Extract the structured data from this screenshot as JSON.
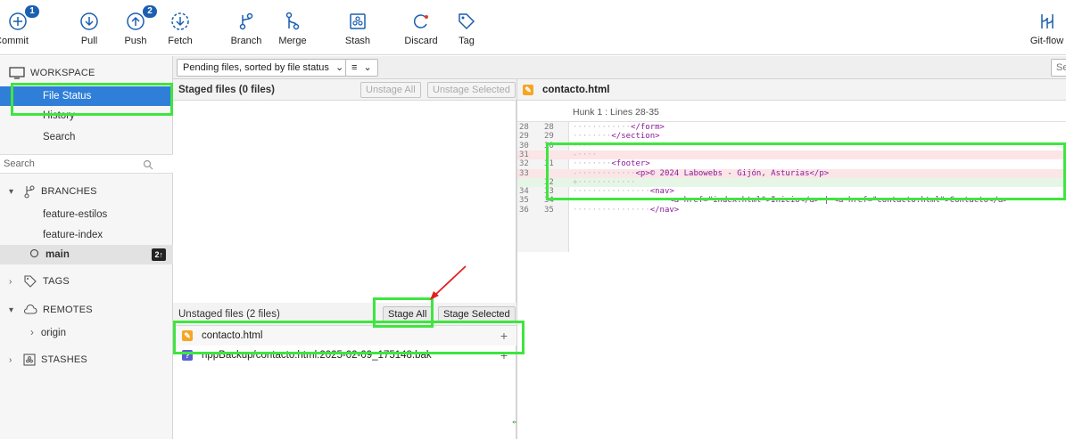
{
  "toolbar": {
    "buttons": [
      {
        "key": "commit",
        "label": "Commit",
        "badge": "1"
      },
      {
        "key": "pull",
        "label": "Pull",
        "badge": ""
      },
      {
        "key": "push",
        "label": "Push",
        "badge": "2"
      },
      {
        "key": "fetch",
        "label": "Fetch",
        "badge": ""
      },
      {
        "key": "branch",
        "label": "Branch",
        "badge": ""
      },
      {
        "key": "merge",
        "label": "Merge",
        "badge": ""
      },
      {
        "key": "stash",
        "label": "Stash",
        "badge": ""
      },
      {
        "key": "discard",
        "label": "Discard",
        "badge": ""
      },
      {
        "key": "tag",
        "label": "Tag",
        "badge": ""
      },
      {
        "key": "gitflow",
        "label": "Git-flow",
        "badge": ""
      }
    ]
  },
  "sidebar": {
    "workspace_label": "WORKSPACE",
    "workspace_items": [
      "File Status",
      "History",
      "Search"
    ],
    "search_placeholder": "Search",
    "branches_label": "BRANCHES",
    "branches": [
      "feature-estilos",
      "feature-index",
      "main"
    ],
    "main_badge": "2↑",
    "tags_label": "TAGS",
    "remotes_label": "REMOTES",
    "remotes": [
      "origin"
    ],
    "stashes_label": "STASHES"
  },
  "filter": {
    "sort_label": "Pending files, sorted by file status",
    "view_icon": "≡",
    "search_placeholder": "Se"
  },
  "staged": {
    "title": "Staged files  (0 files)",
    "unstage_all": "Unstage All",
    "unstage_selected": "Unstage Selected"
  },
  "unstaged": {
    "title": "Unstaged files  (2 files)",
    "stage_all": "Stage All",
    "stage_selected": "Stage Selected",
    "files": [
      "contacto.html",
      "nppBackup/contacto.html.2025-02-09_175148.bak"
    ]
  },
  "diff": {
    "file": "contacto.html",
    "hunk": "Hunk 1 : Lines 28-35",
    "lines": [
      {
        "old": "28",
        "new": "28",
        "type": "ctx",
        "text": "</form>"
      },
      {
        "old": "29",
        "new": "29",
        "type": "ctx",
        "text": "</section>"
      },
      {
        "old": "30",
        "new": "30",
        "type": "ctx",
        "text": ""
      },
      {
        "old": "31",
        "new": "",
        "type": "del",
        "text": ""
      },
      {
        "old": "32",
        "new": "31",
        "type": "ctx",
        "text": "<footer>"
      },
      {
        "old": "33",
        "new": "",
        "type": "del",
        "text": "<p>© 2024 Labowebs - Gijón, Asturias</p>"
      },
      {
        "old": "",
        "new": "32",
        "type": "add",
        "text": ""
      },
      {
        "old": "34",
        "new": "33",
        "type": "ctx",
        "text": "<nav>"
      },
      {
        "old": "35",
        "new": "34",
        "type": "ctx",
        "text": "<a href=\"index.html\">Inicio</a> | <a href=\"contacto.html\">Contacto</a>"
      },
      {
        "old": "36",
        "new": "35",
        "type": "ctx",
        "text": "</nav>"
      }
    ]
  },
  "colors": {
    "highlight": "#3ee63e",
    "selected": "#2f7fd8",
    "arrow": "#e02020",
    "file_modified": "#f5a623",
    "file_untracked": "#5a5fd6"
  }
}
